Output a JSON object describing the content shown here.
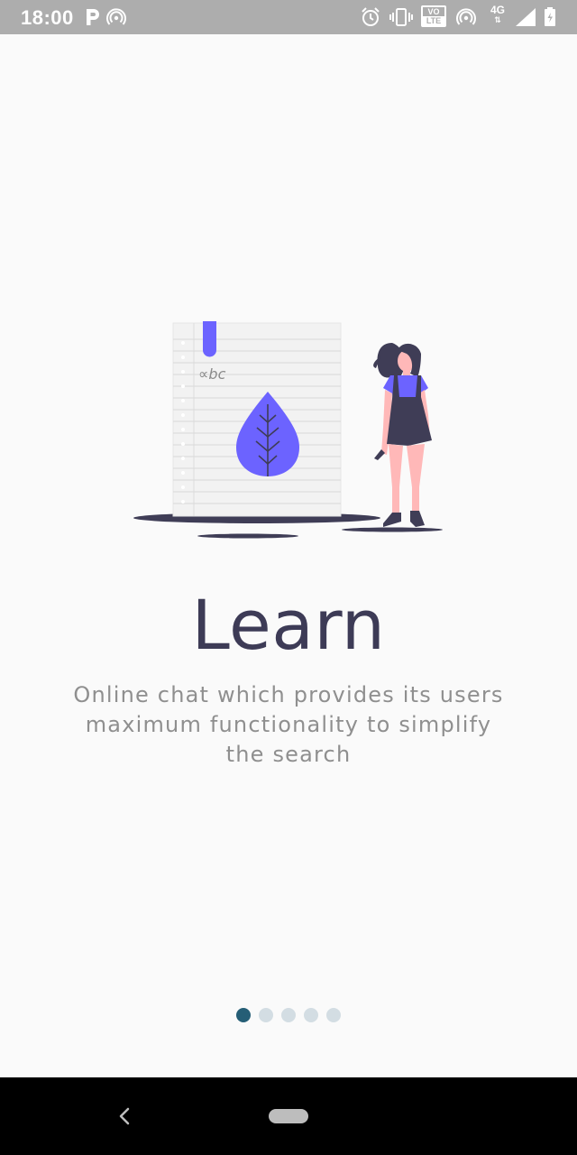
{
  "status_bar": {
    "time": "18:00",
    "left_icons": [
      "parking-icon",
      "wireless-hotspot-icon"
    ],
    "right_icons": [
      "alarm-icon",
      "vibrate-icon",
      "volte-icon",
      "hotspot-icon",
      "network-4g-icon",
      "signal-icon",
      "battery-icon"
    ],
    "volte_label_top": "VO",
    "volte_label_bottom": "LTE",
    "network_label": "4G"
  },
  "illustration": {
    "notebook_text": "∝bc",
    "accent_color": "#6c63ff",
    "dark_color": "#3f3d56"
  },
  "onboarding": {
    "title": "Learn",
    "description": "Online chat which provides its users maximum functionality to simplify the search"
  },
  "pager": {
    "page_count": 5,
    "active_index": 0,
    "active_color": "#255e76",
    "inactive_color": "#d3dde3"
  },
  "nav_bar": {
    "buttons": [
      "back-chevron-icon",
      "home-pill-icon"
    ]
  }
}
